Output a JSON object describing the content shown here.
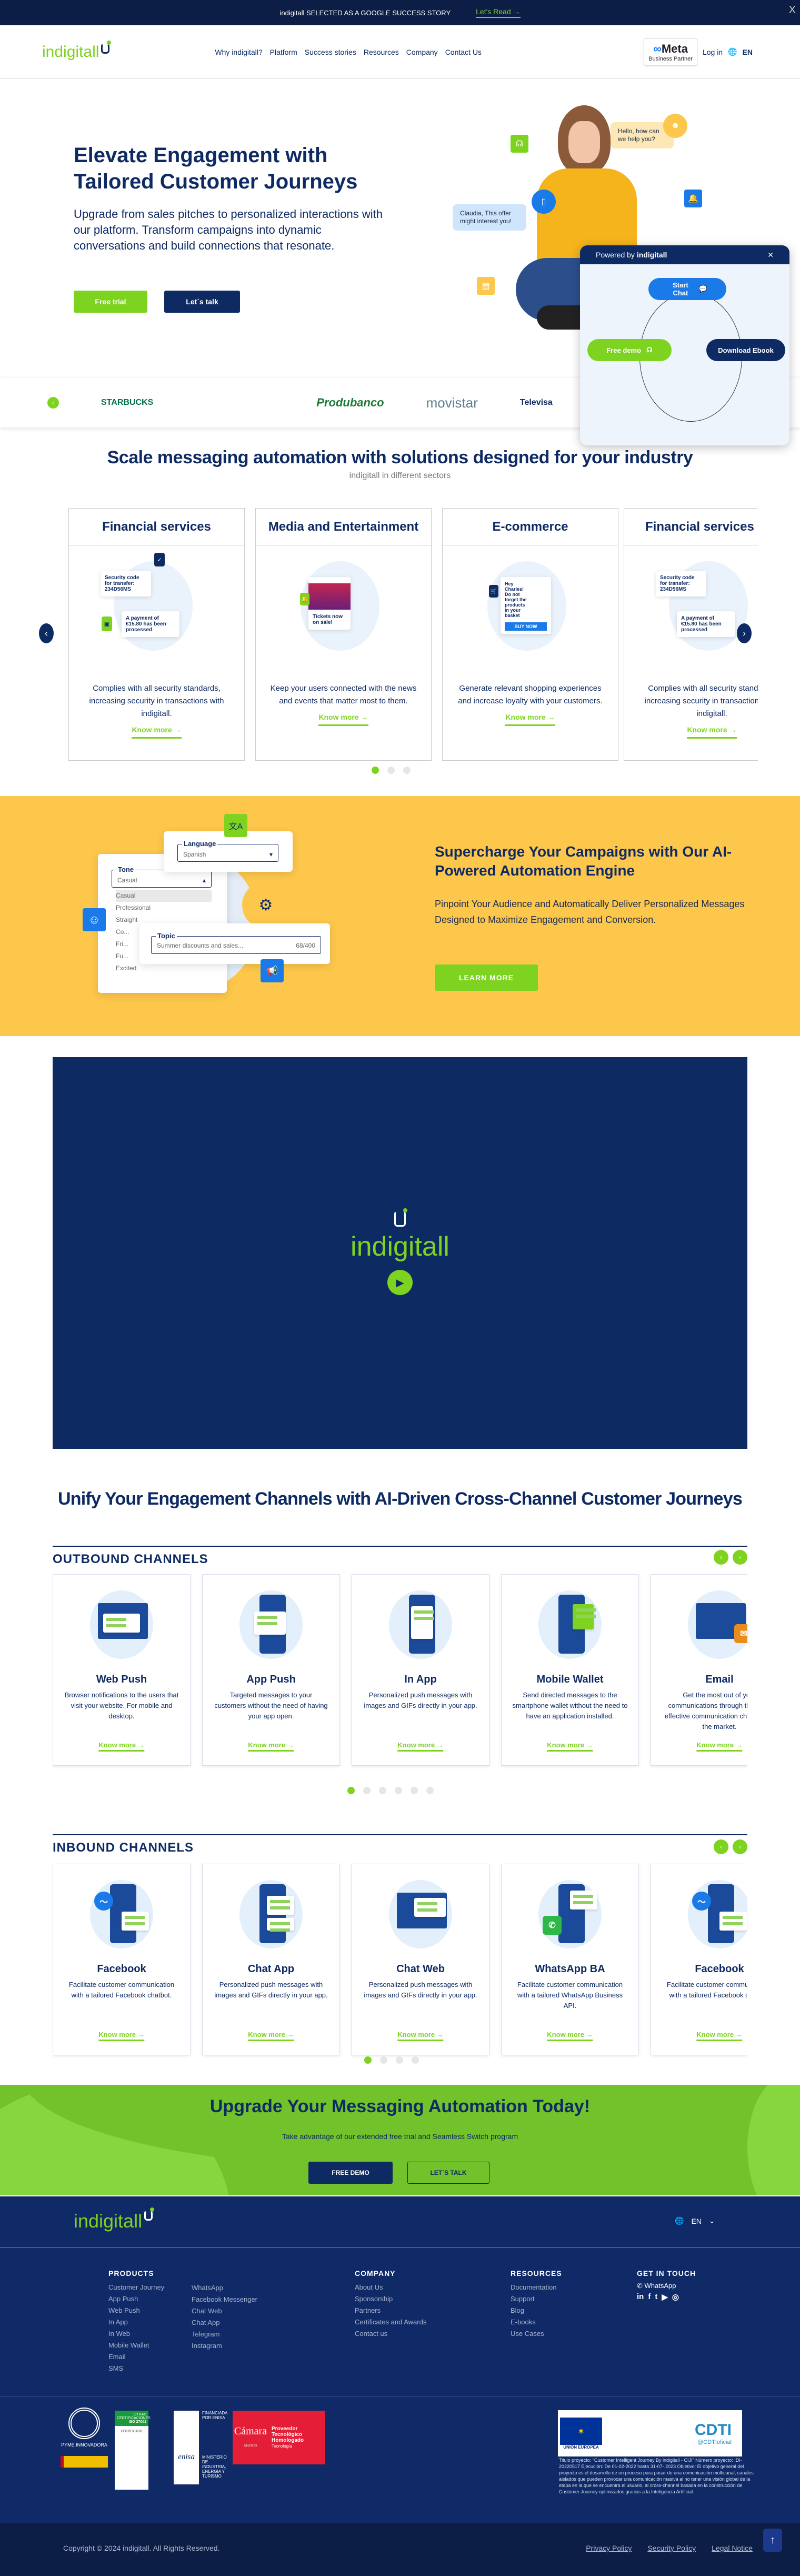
{
  "topbar": {
    "text": "indigitall SELECTED AS A GOOGLE SUCCESS STORY",
    "link": "Let's Read →",
    "close": "X"
  },
  "nav": {
    "logo": "indigitall",
    "items": [
      "Why indigitall?",
      "Platform",
      "Success stories",
      "Resources",
      "Company",
      "Contact Us"
    ],
    "meta_brand": "Meta",
    "meta_sub": "Business Partner",
    "login": "Log in",
    "lang": "EN"
  },
  "hero": {
    "title": "Elevate Engagement with Tailored Customer Journeys",
    "subtitle": "Upgrade from sales pitches to personalized interactions with our platform. Transform campaigns into dynamic conversations and build connections that resonate.",
    "btn_trial": "Free trial",
    "btn_talk": "Let´s talk",
    "bubble_bot": "Hello, how can we help you?",
    "bubble_offer": "Claudia, This offer might interest you!"
  },
  "widget": {
    "powered_prefix": "Powered by",
    "powered_brand": "indigitall",
    "close": "✕",
    "start_chat": "Start Chat",
    "free_demo": "Free demo",
    "download": "Download Ebook"
  },
  "logos": [
    "STARBUCKS",
    "Produbanco",
    "movistar",
    "Televisa"
  ],
  "sectors": {
    "title": "Scale messaging automation with solutions designed for your industry",
    "subtitle": "indigitall in different sectors",
    "cards": [
      {
        "title": "Financial services",
        "desc": "Complies with all security standards, increasing security in transactions with indigitall.",
        "note1": "Security code for transfer: 234D56MS",
        "note2": "A payment of €15.80 has been processed"
      },
      {
        "title": "Media and Entertainment",
        "desc": "Keep your users connected with the news and events that matter most to them.",
        "note1": "Tickets now on sale!"
      },
      {
        "title": "E-commerce",
        "desc": "Generate relevant shopping experiences and increase loyalty with your customers.",
        "note1": "Hey Charles! Do not forget the products in your basket",
        "note2": "BUY NOW"
      },
      {
        "title": "Financial services",
        "desc": "Complies with all security standards, increasing security in transactions with indigitall.",
        "note1": "Security code for transfer: 234D56MS",
        "note2": "A payment of €15.80 has been processed"
      }
    ],
    "know_more": "Know more →",
    "active_dot": 0,
    "dot_count": 3
  },
  "ai": {
    "title": "Supercharge Your Campaigns with Our AI-Powered Automation Engine",
    "desc": "Pinpoint Your Audience and Automatically Deliver Personalized Messages Designed to Maximize Engagement and Conversion.",
    "btn": "LEARN MORE",
    "language_label": "Language",
    "language_value": "Spanish",
    "tone_label": "Tone",
    "tone_value": "Casual",
    "tone_options": [
      "Casual",
      "Professional",
      "Straight",
      "Co...",
      "Fri...",
      "Fu...",
      "Excited"
    ],
    "topic_label": "Topic",
    "topic_value": "Summer discounts and sales...",
    "topic_count": "68/400"
  },
  "video": {
    "brand": "indigitall"
  },
  "unify_title": "Unify Your Engagement Channels with AI-Driven Cross-Channel Customer Journeys",
  "outbound": {
    "title": "OUTBOUND CHANNELS",
    "cards": [
      {
        "title": "Web Push",
        "desc": "Browser notifications to the users that visit your website. For mobile and desktop."
      },
      {
        "title": "App Push",
        "desc": "Targeted messages to your customers without the need of having your app open."
      },
      {
        "title": "In App",
        "desc": "Personalized push messages with images and GIFs directly in your app."
      },
      {
        "title": "Mobile Wallet",
        "desc": "Send directed messages to the smartphone wallet without the need to have an application installed."
      },
      {
        "title": "Email",
        "desc": "Get the most out of your communications through the most effective communication channels in the market."
      }
    ],
    "active_dot": 0,
    "dot_count": 6
  },
  "inbound": {
    "title": "INBOUND CHANNELS",
    "cards": [
      {
        "title": "Facebook",
        "desc": "Facilitate customer communication with a tailored Facebook chatbot."
      },
      {
        "title": "Chat App",
        "desc": "Personalized push messages with images and GIFs directly in your app."
      },
      {
        "title": "Chat Web",
        "desc": "Personalized push messages with images and GIFs directly in your app."
      },
      {
        "title": "WhatsApp BA",
        "desc": "Facilitate customer communication with a tailored WhatsApp Business API."
      },
      {
        "title": "Facebook",
        "desc": "Facilitate customer communication with a tailored Facebook chatbot."
      }
    ],
    "active_dot": 0,
    "dot_count": 4
  },
  "know_more": "Know more →",
  "cta": {
    "title": "Upgrade Your Messaging Automation Today!",
    "sub": "Take advantage of our extended free trial and Seamless Switch program",
    "btn_demo": "FREE DEMO",
    "btn_talk": "LET´S TALK"
  },
  "footer": {
    "logo": "indigitall",
    "lang": "EN",
    "products_title": "PRODUCTS",
    "products_a": [
      "Customer Journey",
      "App Push",
      "Web Push",
      "In App",
      "In Web",
      "Mobile Wallet",
      "Email",
      "SMS"
    ],
    "products_b": [
      "WhatsApp",
      "Facebook Messenger",
      "Chat Web",
      "Chat App",
      "Telegram",
      "Instagram"
    ],
    "company_title": "COMPANY",
    "company": [
      "About Us",
      "Sponsorship",
      "Partners",
      "Certificates and Awards",
      "Contact us"
    ],
    "resources_title": "RESOURCES",
    "resources": [
      "Documentation",
      "Support",
      "Blog",
      "E-books",
      "Use Cases"
    ],
    "touch_title": "GET IN TOUCH",
    "whatsapp": "WhatsApp",
    "socials": [
      "in",
      "f",
      "t",
      "▶",
      "◎"
    ],
    "certs": {
      "pyme": "PYME INNOVADORA",
      "iso_top": "OTRAS CERTIFICACIONES",
      "iso": "ISO 27001",
      "iso_sub": "CERTIFICADO",
      "enisa": "enisa",
      "enisa_fin": "FINANCIADA POR ENISA",
      "enisa_min": "MINISTERIO DE INDUSTRIA, ENERGIA Y TURISMO",
      "camara": "Cámara",
      "camara_sub": "MADRID",
      "camara_prov": "Proveedor Tecnológico Homologado",
      "camara_tec": "Tecnología",
      "eu": "UNIÓN EUROPEA",
      "cdti": "CDTI",
      "cdti_handle": "@CDTIoficial"
    },
    "project": "Titulo proyecto: \"Customer Intelligent Journey By indigitall - CIJI\" Número proyecto: IDI-20220517 Ejecución: De 01-02-2022 hasta 31-07- 2023 Objetivo: El objetivo general del proyecto es el desarrollo de un proceso para pasar de una comunicación multicanal, canales aislados que pueden provocar una comunicación masiva al no tener una visión global de la etapa en la que se encuentra el usuario, al cross-channel basada en la construcción de Customer Journey optimizados gracias a la Inteligencia Artificial."
  },
  "bottom": {
    "copyright": "Copyright © 2024 indigitall. All Rights Reserved.",
    "links": [
      "Privacy Policy",
      "Security Policy",
      "Legal Notice"
    ]
  },
  "colors": {
    "navy": "#0e2a63",
    "green": "#7ed321",
    "yellow": "#fdc74b",
    "blue": "#1a7be8"
  }
}
